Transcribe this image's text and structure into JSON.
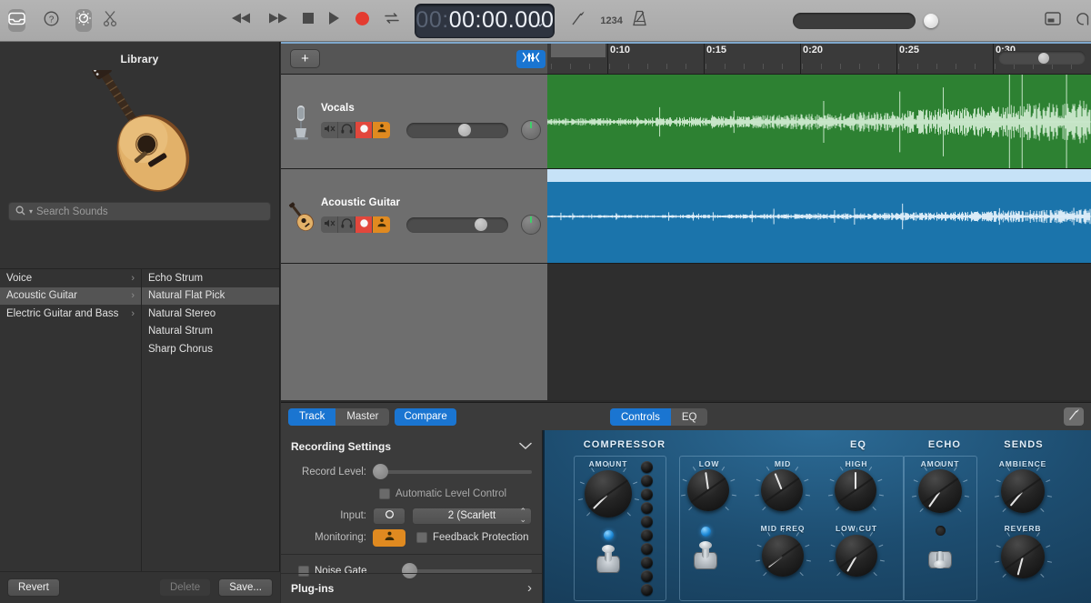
{
  "toolbar": {
    "library_toggle": "library-icon",
    "help": "help-icon",
    "smart_controls": "smart-controls-icon",
    "scissors": "scissors-icon",
    "rewind": "rewind-icon",
    "forward": "forward-icon",
    "stop": "stop-icon",
    "play": "play-icon",
    "record": "record-icon",
    "cycle": "cycle-icon",
    "lcd_dim": "00:",
    "lcd_value": "00:00.000",
    "lcd_chevron": "⌄",
    "tuner": "tuner-icon",
    "count_in": "1234",
    "metronome": "metronome-icon",
    "notes_panel": "notes-icon",
    "loop_browser": "loop-browser-icon",
    "accent_blue": "#1a75d1",
    "record_red": "#e2473c"
  },
  "library": {
    "title": "Library",
    "artwork": "acoustic-guitar-artwork",
    "search_placeholder": "Search Sounds",
    "categories": [
      {
        "label": "Voice",
        "selected": false
      },
      {
        "label": "Acoustic Guitar",
        "selected": true
      },
      {
        "label": "Electric Guitar and Bass",
        "selected": false
      }
    ],
    "patches": [
      {
        "label": "Echo Strum",
        "selected": false
      },
      {
        "label": "Natural Flat Pick",
        "selected": true
      },
      {
        "label": "Natural Stereo",
        "selected": false
      },
      {
        "label": "Natural Strum",
        "selected": false
      },
      {
        "label": "Sharp Chorus",
        "selected": false
      }
    ],
    "footer": {
      "revert": "Revert",
      "delete": "Delete",
      "save": "Save..."
    }
  },
  "tracks": {
    "add_track": "+",
    "mixer_toggle": "mixer-icon",
    "ruler": {
      "labels": [
        "0:10",
        "0:15",
        "0:20",
        "0:25",
        "0:30"
      ],
      "positions": [
        66,
        172,
        278,
        384,
        490
      ]
    },
    "list": [
      {
        "name": "Vocals",
        "icon": "microphone-icon",
        "region_color": "#2d8132",
        "mute": "mute-icon",
        "solo": "headphones-icon",
        "record": "record-icon",
        "monitor": "input-monitor-icon",
        "volume": 0.57,
        "pan": 0
      },
      {
        "name": "Acoustic Guitar",
        "icon": "acoustic-guitar-icon",
        "region_color": "#1b74ab",
        "mute": "mute-icon",
        "solo": "headphones-icon",
        "record": "record-icon",
        "monitor": "input-monitor-icon",
        "volume": 0.71,
        "pan": 0
      }
    ]
  },
  "editor": {
    "view_tabs": [
      {
        "label": "Track",
        "active": true
      },
      {
        "label": "Master",
        "active": false
      }
    ],
    "compare": "Compare",
    "mode_tabs": [
      {
        "label": "Controls",
        "active": true
      },
      {
        "label": "EQ",
        "active": false
      }
    ],
    "edit_icon": "pen-icon",
    "recording": {
      "title": "Recording Settings",
      "collapse_icon": "chevron-down-icon",
      "record_level_label": "Record Level:",
      "record_level_value": 0,
      "auto_level_label": "Automatic Level Control",
      "auto_level_checked": false,
      "input_label": "Input:",
      "input_mode_icon": "mono-icon",
      "input_value": "2  (Scarlett",
      "monitoring_label": "Monitoring:",
      "monitoring_icon": "input-monitor-icon",
      "monitoring_on": true,
      "feedback_label": "Feedback Protection",
      "feedback_checked": false,
      "noise_gate_label": "Noise Gate",
      "noise_gate_checked": false,
      "noise_gate_value": 0,
      "plugins_label": "Plug-ins",
      "plugins_chevron": "›"
    },
    "plugin": {
      "sections": [
        {
          "title": "COMPRESSOR",
          "knobs": [
            {
              "label": "AMOUNT",
              "angle": -135
            }
          ],
          "led_on": true,
          "toggle_up": true,
          "meter_leds": 10
        },
        {
          "title": "EQ",
          "knobs": [
            {
              "label": "LOW",
              "angle": -8
            },
            {
              "label": "MID",
              "angle": -22
            },
            {
              "label": "HIGH",
              "angle": 0
            },
            {
              "label": "MID FREQ",
              "angle": -128
            },
            {
              "label": "LOW CUT",
              "angle": -150
            }
          ],
          "led_on": true,
          "toggle_up": true
        },
        {
          "title": "ECHO",
          "knobs": [
            {
              "label": "AMOUNT",
              "angle": -145
            }
          ],
          "led_on": false,
          "toggle_up": false
        },
        {
          "title": "SENDS",
          "knobs": [
            {
              "label": "AMBIENCE",
              "angle": -140
            },
            {
              "label": "REVERB",
              "angle": -165
            }
          ]
        }
      ]
    }
  }
}
